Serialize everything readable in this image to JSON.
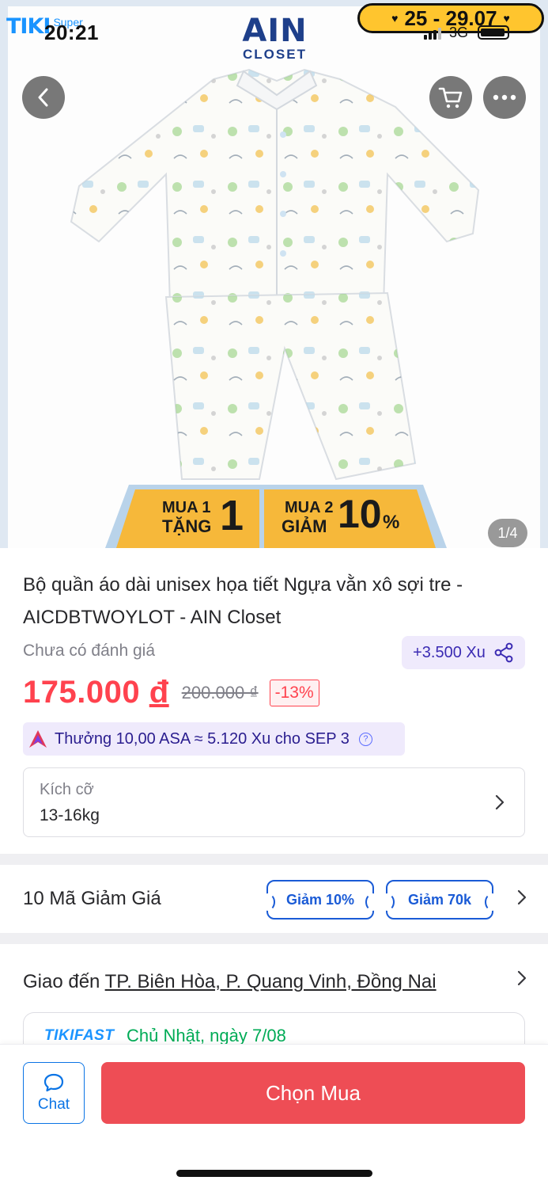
{
  "status_bar": {
    "time": "20:21",
    "network": "3G"
  },
  "header": {
    "tiki_logo": "TIKI",
    "tiki_super": "Super",
    "brand_logo_main": "AIN",
    "brand_logo_sub": "CLOSET",
    "campaign_dates": "25 - 29.07",
    "back_icon": "chevron-left-icon",
    "cart_icon": "cart-icon",
    "more_icon": "more-horizontal-icon"
  },
  "gallery": {
    "counter": "1/4",
    "promo_left_line1": "MUA 1",
    "promo_left_line2": "TẶNG",
    "promo_left_big": "1",
    "promo_right_line1": "MUA 2",
    "promo_right_line2": "GIẢM",
    "promo_right_big": "10",
    "promo_right_pct": "%"
  },
  "product": {
    "title": "Bộ quần áo dài unisex họa tiết Ngựa vằn xô sợi tre - AICDBTWOYLOT - AIN Closet",
    "rating_text": "Chưa có đánh giá",
    "xu_reward": "+3.500 Xu",
    "price": "175.000",
    "currency": "đ",
    "old_price": "200.000 ₫",
    "discount": "-13%",
    "asa_reward": "Thưởng 10,00 ASA ≈ 5.120 Xu cho SEP 3"
  },
  "size_selector": {
    "label": "Kích cỡ",
    "value": "13-16kg"
  },
  "coupons": {
    "title": "10 Mã Giảm Giá",
    "chips": [
      "Giảm 10%",
      "Giảm 70k"
    ]
  },
  "delivery": {
    "prefix": "Giao đến",
    "address": "TP. Biên Hòa, P. Quang Vinh, Đồng Nai",
    "fast_logo": "TIKIFAST",
    "fast_date": "Chủ Nhật, ngày 7/08"
  },
  "bottom_bar": {
    "chat_label": "Chat",
    "buy_label": "Chọn Mua"
  },
  "colors": {
    "price_red": "#ff424e",
    "tiki_blue": "#1a94ff",
    "buy_button": "#ee4d55",
    "brand_navy": "#1e3f8a",
    "promo_yellow": "#f6b83a"
  }
}
